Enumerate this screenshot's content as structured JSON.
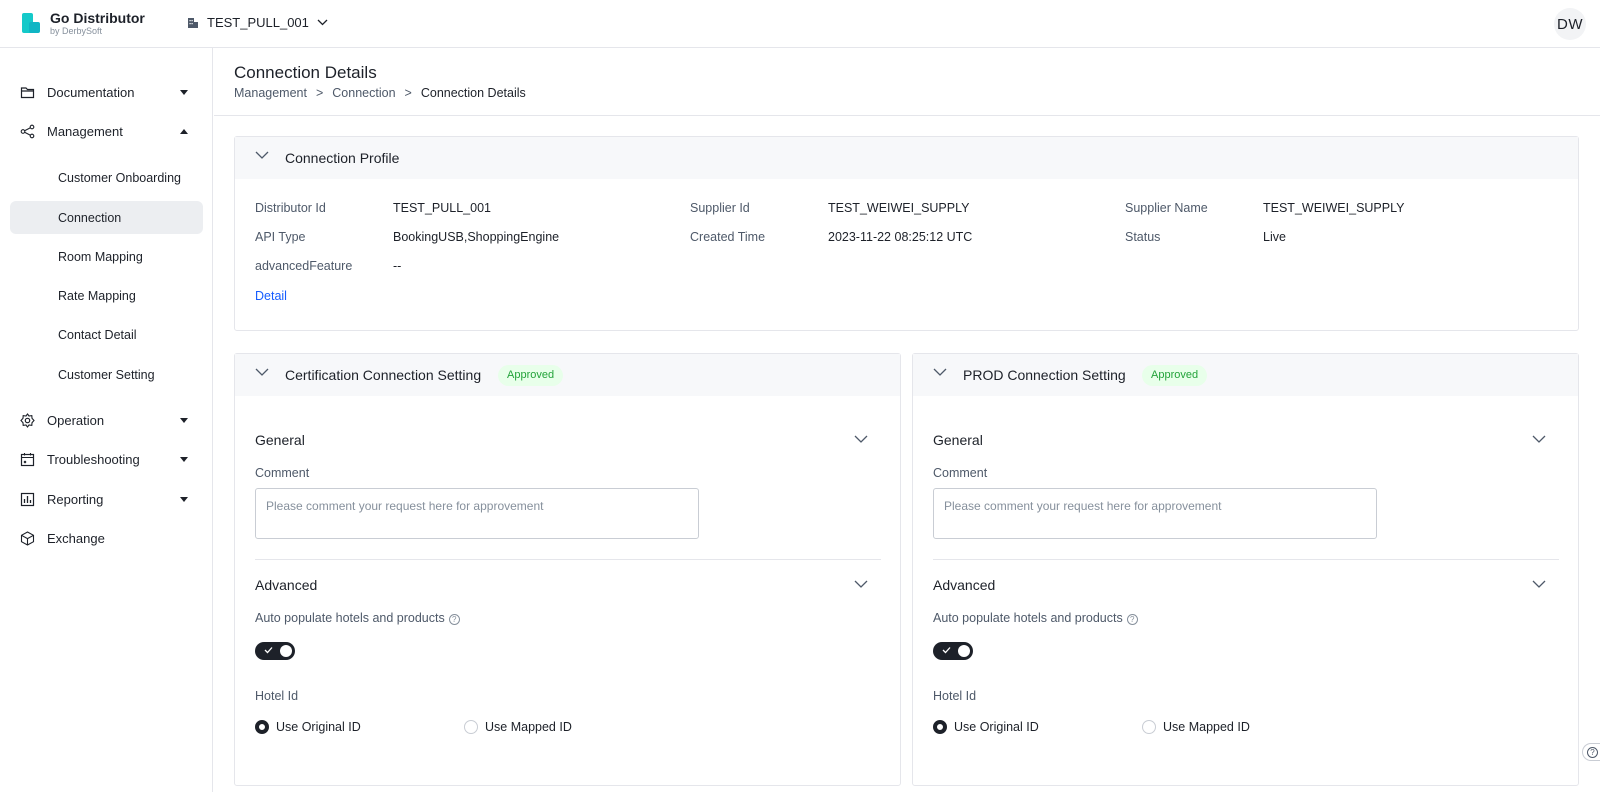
{
  "app": {
    "name": "Go Distributor",
    "subtitle": "by DerbySoft"
  },
  "header": {
    "tenant": "TEST_PULL_001",
    "avatar_initials": "DW"
  },
  "sidebar": {
    "documentation": "Documentation",
    "management": "Management",
    "management_items": [
      "Customer Onboarding",
      "Connection",
      "Room Mapping",
      "Rate Mapping",
      "Contact Detail",
      "Customer Setting"
    ],
    "active_item": "Connection",
    "operation": "Operation",
    "troubleshooting": "Troubleshooting",
    "reporting": "Reporting",
    "exchange": "Exchange"
  },
  "page": {
    "title": "Connection Details",
    "breadcrumb": [
      "Management",
      "Connection",
      "Connection Details"
    ],
    "breadcrumb_sep": ">"
  },
  "profile": {
    "title": "Connection Profile",
    "fields": {
      "distributor_id_label": "Distributor Id",
      "distributor_id": "TEST_PULL_001",
      "supplier_id_label": "Supplier Id",
      "supplier_id": "TEST_WEIWEI_SUPPLY",
      "supplier_name_label": "Supplier Name",
      "supplier_name": "TEST_WEIWEI_SUPPLY",
      "api_type_label": "API Type",
      "api_type": "BookingUSB,ShoppingEngine",
      "created_time_label": "Created Time",
      "created_time": "2023-11-22 08:25:12 UTC",
      "status_label": "Status",
      "status": "Live",
      "advanced_feature_label": "advancedFeature",
      "advanced_feature": "--"
    },
    "detail_link": "Detail"
  },
  "cert": {
    "title": "Certification Connection Setting",
    "badge": "Approved",
    "general": "General",
    "comment_label": "Comment",
    "comment_placeholder": "Please comment your request here for approvement",
    "advanced": "Advanced",
    "auto_populate_label": "Auto populate hotels and products",
    "auto_populate": true,
    "hotel_id_label": "Hotel Id",
    "radio_original": "Use Original ID",
    "radio_mapped": "Use Mapped ID",
    "selected": "Use Original ID"
  },
  "prod": {
    "title": "PROD Connection Setting",
    "badge": "Approved",
    "general": "General",
    "comment_label": "Comment",
    "comment_placeholder": "Please comment your request here for approvement",
    "advanced": "Advanced",
    "auto_populate_label": "Auto populate hotels and products",
    "auto_populate": true,
    "hotel_id_label": "Hotel Id",
    "radio_original": "Use Original ID",
    "radio_mapped": "Use Mapped ID",
    "selected": "Use Original ID"
  },
  "colors": {
    "brand": "#14c9c9",
    "link": "#165dff",
    "badge_bg": "#e8ffea",
    "badge_text": "#23a33a",
    "active_bg": "#eceef1"
  }
}
